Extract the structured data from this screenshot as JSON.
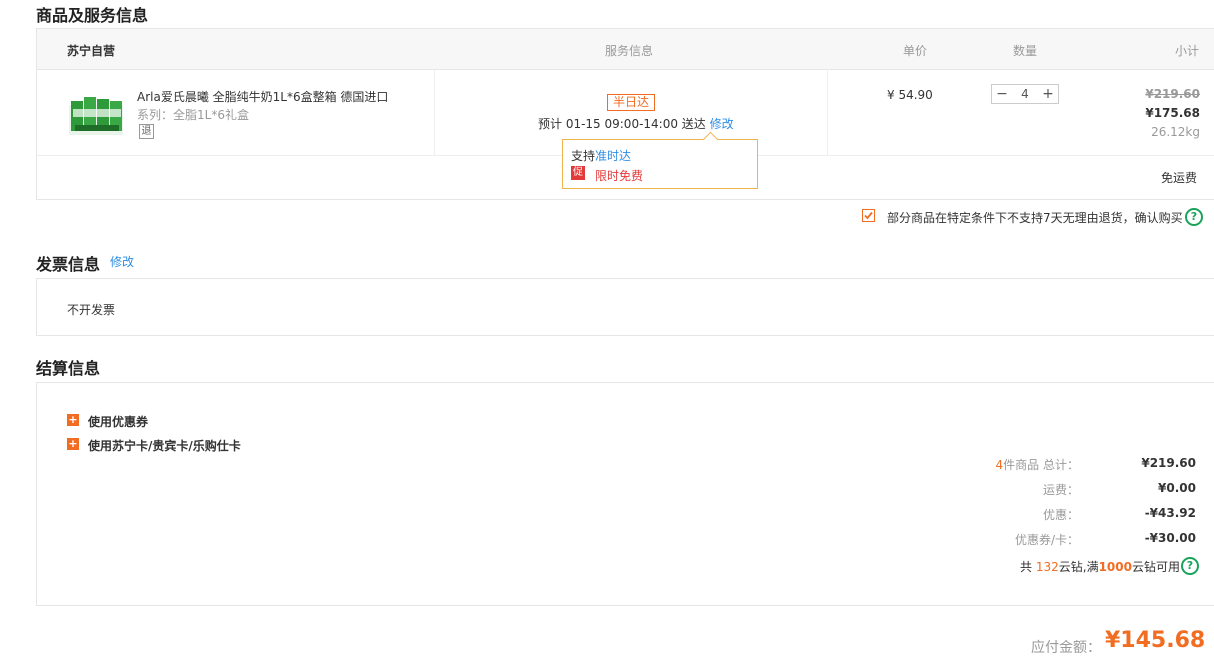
{
  "sections": {
    "goods_title": "商品及服务信息",
    "invoice_title": "发票信息",
    "invoice_edit": "修改",
    "settle_title": "结算信息"
  },
  "table": {
    "store": "苏宁自营",
    "col_service": "服务信息",
    "col_price": "单价",
    "col_qty": "数量",
    "col_subtotal": "小计"
  },
  "product": {
    "name": "Arla爱氏晨曦 全脂纯牛奶1L*6盒整箱 德国进口",
    "series": "系列：全脂1L*6礼盒",
    "return_badge": "退",
    "price": "¥ 54.90",
    "quantity": "4",
    "original_total": "¥219.60",
    "total": "¥175.68",
    "weight": "26.12kg"
  },
  "service": {
    "badge": "半日达",
    "eta": "预计 01-15 09:00-14:00  送达",
    "edit": "修改",
    "tooltip_prefix": "支持",
    "tooltip_link": "准时达",
    "promo_icon": "促",
    "promo_text": "限时免费"
  },
  "shipping": {
    "label": "免运费"
  },
  "agreement": {
    "text": "部分商品在特定条件下不支持7天无理由退货，确认购买"
  },
  "invoice": {
    "value": "不开发票"
  },
  "settle": {
    "coupon": "使用优惠券",
    "card": "使用苏宁卡/贵宾卡/乐购仕卡",
    "count_num": "4",
    "count_label": "件商品 总计：",
    "total_value": "¥219.60",
    "freight_label": "运费：",
    "freight_value": "¥0.00",
    "discount_label": "优惠：",
    "discount_value": "-¥43.92",
    "coupon_label": "优惠券/卡：",
    "coupon_value": "-¥30.00",
    "diamond_pre": "共 ",
    "diamond_num": "132",
    "diamond_mid": "云钻,满",
    "diamond_threshold": "1000",
    "diamond_post": "云钻可用"
  },
  "payment": {
    "label": "应付金额：",
    "amount": "¥145.68"
  },
  "colors": {
    "accent": "#f26c21",
    "link": "#2e8de6",
    "help": "#1aa35a",
    "promo": "#e23a3a"
  }
}
